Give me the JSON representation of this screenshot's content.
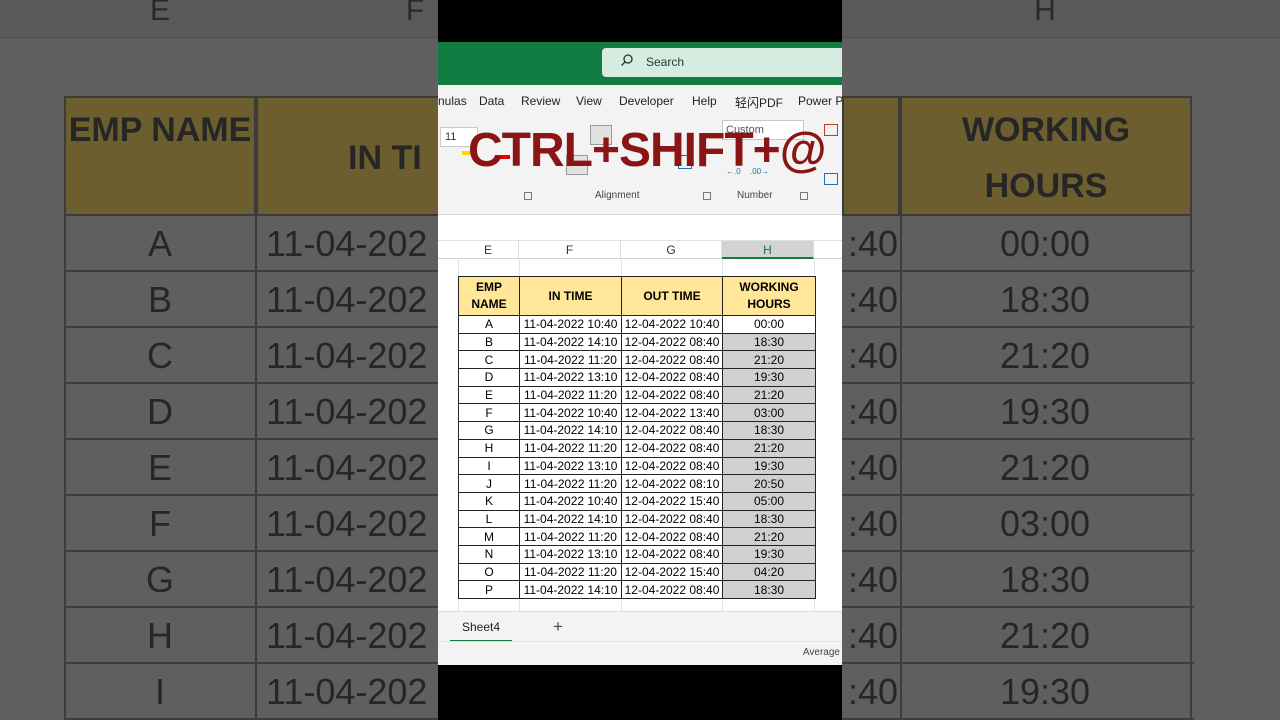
{
  "search": {
    "placeholder": "Search"
  },
  "ribbon": {
    "tabs": [
      "nulas",
      "Data",
      "Review",
      "View",
      "Developer",
      "Help",
      "轻闪PDF",
      "Power Pi"
    ],
    "font_size": "11",
    "number_format": "Custom",
    "groups": [
      "Alignment",
      "Number"
    ]
  },
  "overlay": {
    "shortcut": "CTRL+SHIFT+@"
  },
  "sheet": {
    "column_letters": [
      "E",
      "F",
      "G",
      "H"
    ],
    "headers": [
      "EMP NAME",
      "IN TIME",
      "OUT TIME",
      "WORKING HOURS"
    ],
    "rows": [
      [
        "A",
        "11-04-2022 10:40",
        "12-04-2022 10:40",
        "00:00"
      ],
      [
        "B",
        "11-04-2022 14:10",
        "12-04-2022 08:40",
        "18:30"
      ],
      [
        "C",
        "11-04-2022 11:20",
        "12-04-2022 08:40",
        "21:20"
      ],
      [
        "D",
        "11-04-2022 13:10",
        "12-04-2022 08:40",
        "19:30"
      ],
      [
        "E",
        "11-04-2022 11:20",
        "12-04-2022 08:40",
        "21:20"
      ],
      [
        "F",
        "11-04-2022 10:40",
        "12-04-2022 13:40",
        "03:00"
      ],
      [
        "G",
        "11-04-2022 14:10",
        "12-04-2022 08:40",
        "18:30"
      ],
      [
        "H",
        "11-04-2022 11:20",
        "12-04-2022 08:40",
        "21:20"
      ],
      [
        "I",
        "11-04-2022 13:10",
        "12-04-2022 08:40",
        "19:30"
      ],
      [
        "J",
        "11-04-2022 11:20",
        "12-04-2022 08:10",
        "20:50"
      ],
      [
        "K",
        "11-04-2022 10:40",
        "12-04-2022 15:40",
        "05:00"
      ],
      [
        "L",
        "11-04-2022 14:10",
        "12-04-2022 08:40",
        "18:30"
      ],
      [
        "M",
        "11-04-2022 11:20",
        "12-04-2022 08:40",
        "21:20"
      ],
      [
        "N",
        "11-04-2022 13:10",
        "12-04-2022 08:40",
        "19:30"
      ],
      [
        "O",
        "11-04-2022 11:20",
        "12-04-2022 15:40",
        "04:20"
      ],
      [
        "P",
        "11-04-2022 14:10",
        "12-04-2022 08:40",
        "18:30"
      ]
    ],
    "tab_name": "Sheet4",
    "add_sheet": "+"
  },
  "status": {
    "average": "Average"
  },
  "background": {
    "column_letters": [
      "E",
      "F",
      "H"
    ],
    "header_left": "EMP NAME",
    "header_mid": "IN TI",
    "header_right": "WORKING HOURS",
    "names": [
      "A",
      "B",
      "C",
      "D",
      "E",
      "F",
      "G",
      "H",
      "I"
    ],
    "in_time_partial": "11-04-202",
    "out_partial": ":40",
    "hours": [
      "00:00",
      "18:30",
      "21:20",
      "19:30",
      "21:20",
      "03:00",
      "18:30",
      "21:20",
      "19:30"
    ]
  },
  "colors": {
    "excel_green": "#107c41",
    "header_fill": "#ffe699",
    "selection_fill": "#d0d0d0",
    "overlay_text": "#8b1414"
  }
}
